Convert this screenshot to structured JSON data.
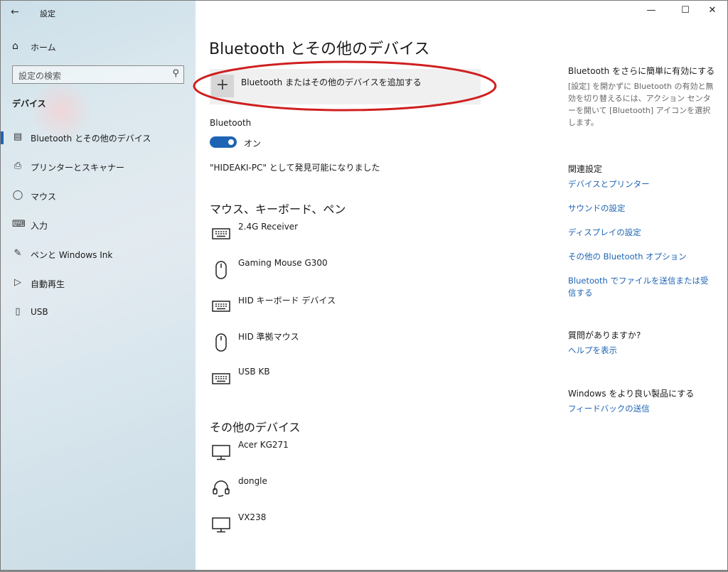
{
  "window": {
    "title": "設定"
  },
  "sidebar": {
    "home_label": "ホーム",
    "search_placeholder": "設定の検索",
    "section_label": "デバイス",
    "items": [
      {
        "label": "Bluetooth とその他のデバイス",
        "icon": "bluetooth-devices-icon",
        "active": true
      },
      {
        "label": "プリンターとスキャナー",
        "icon": "printer-icon",
        "active": false
      },
      {
        "label": "マウス",
        "icon": "mouse-icon",
        "active": false
      },
      {
        "label": "入力",
        "icon": "keyboard-icon",
        "active": false
      },
      {
        "label": "ペンと Windows Ink",
        "icon": "pen-icon",
        "active": false
      },
      {
        "label": "自動再生",
        "icon": "autoplay-icon",
        "active": false
      },
      {
        "label": "USB",
        "icon": "usb-icon",
        "active": false
      }
    ]
  },
  "main": {
    "title": "Bluetooth とその他のデバイス",
    "add_device_label": "Bluetooth またはその他のデバイスを追加する",
    "bluetooth_label": "Bluetooth",
    "bluetooth_state": "オン",
    "discoverable_text": "\"HIDEAKI-PC\" として発見可能になりました",
    "input_section_title": "マウス、キーボード、ペン",
    "input_devices": [
      {
        "name": "2.4G Receiver",
        "icon": "keyboard-icon"
      },
      {
        "name": "Gaming Mouse G300",
        "icon": "mouse-icon"
      },
      {
        "name": "HID キーボード デバイス",
        "icon": "keyboard-icon"
      },
      {
        "name": "HID 準拠マウス",
        "icon": "mouse-icon"
      },
      {
        "name": "USB KB",
        "icon": "keyboard-icon"
      }
    ],
    "other_section_title": "その他のデバイス",
    "other_devices": [
      {
        "name": "Acer KG271",
        "icon": "monitor-icon"
      },
      {
        "name": "dongle",
        "icon": "headset-icon"
      },
      {
        "name": "VX238",
        "icon": "monitor-icon"
      }
    ]
  },
  "right": {
    "tip_title": "Bluetooth をさらに簡単に有効にする",
    "tip_body": "[設定] を開かずに Bluetooth の有効と無効を切り替えるには、アクション センターを開いて [Bluetooth] アイコンを選択します。",
    "related_title": "関連設定",
    "related_links": [
      "デバイスとプリンター",
      "サウンドの設定",
      "ディスプレイの設定",
      "その他の Bluetooth オプション",
      "Bluetooth でファイルを送信または受信する"
    ],
    "question_title": "質問がありますか?",
    "help_link": "ヘルプを表示",
    "improve_title": "Windows をより良い製品にする",
    "feedback_link": "フィードバックの送信"
  },
  "colors": {
    "accent": "#1e64b4",
    "annotation": "#d01f1f"
  }
}
